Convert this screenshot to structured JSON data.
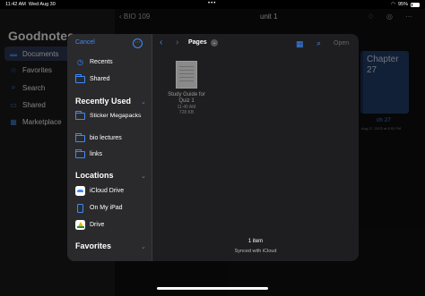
{
  "status_bar": {
    "time": "11:42 AM",
    "date": "Wed Aug 30",
    "battery": "95%"
  },
  "background": {
    "app_title": "Goodnotes",
    "sidebar": [
      {
        "label": "Documents",
        "icon": "folder-icon",
        "active": true
      },
      {
        "label": "Favorites",
        "icon": "star-icon"
      },
      {
        "label": "Search",
        "icon": "search-icon"
      },
      {
        "label": "Shared",
        "icon": "shared-icon"
      },
      {
        "label": "Marketplace",
        "icon": "marketplace-icon"
      }
    ],
    "breadcrumb": "BIO 109",
    "folder_title": "unit 1",
    "notebook": {
      "cover_text": "Chapter 27",
      "caption": "ch 27",
      "date": "Aug 27, 2023 at 8:52 PM"
    }
  },
  "dialog": {
    "cancel": "Cancel",
    "recents": "Recents",
    "shared": "Shared",
    "sections": {
      "recently_used": "Recently Used",
      "locations": "Locations",
      "favorites": "Favorites"
    },
    "recent_folders": [
      "Sticker Megapacks",
      "bio lectures",
      "links"
    ],
    "locations": [
      {
        "label": "iCloud Drive",
        "icon": "icloud-icon"
      },
      {
        "label": "On My iPad",
        "icon": "ipad-icon"
      },
      {
        "label": "Drive",
        "icon": "google-drive-icon"
      }
    ],
    "location_title": "Pages",
    "open": "Open",
    "file": {
      "name": "Study Guide for Quiz 1",
      "time": "11:40 AM",
      "size": "728 KB"
    },
    "footer": {
      "count": "1 item",
      "sync": "Synced with iCloud"
    }
  },
  "colors": {
    "accent": "#3d8af7",
    "dialog_bg": "#1e1e20",
    "sidebar_bg": "#2a2a2c"
  }
}
